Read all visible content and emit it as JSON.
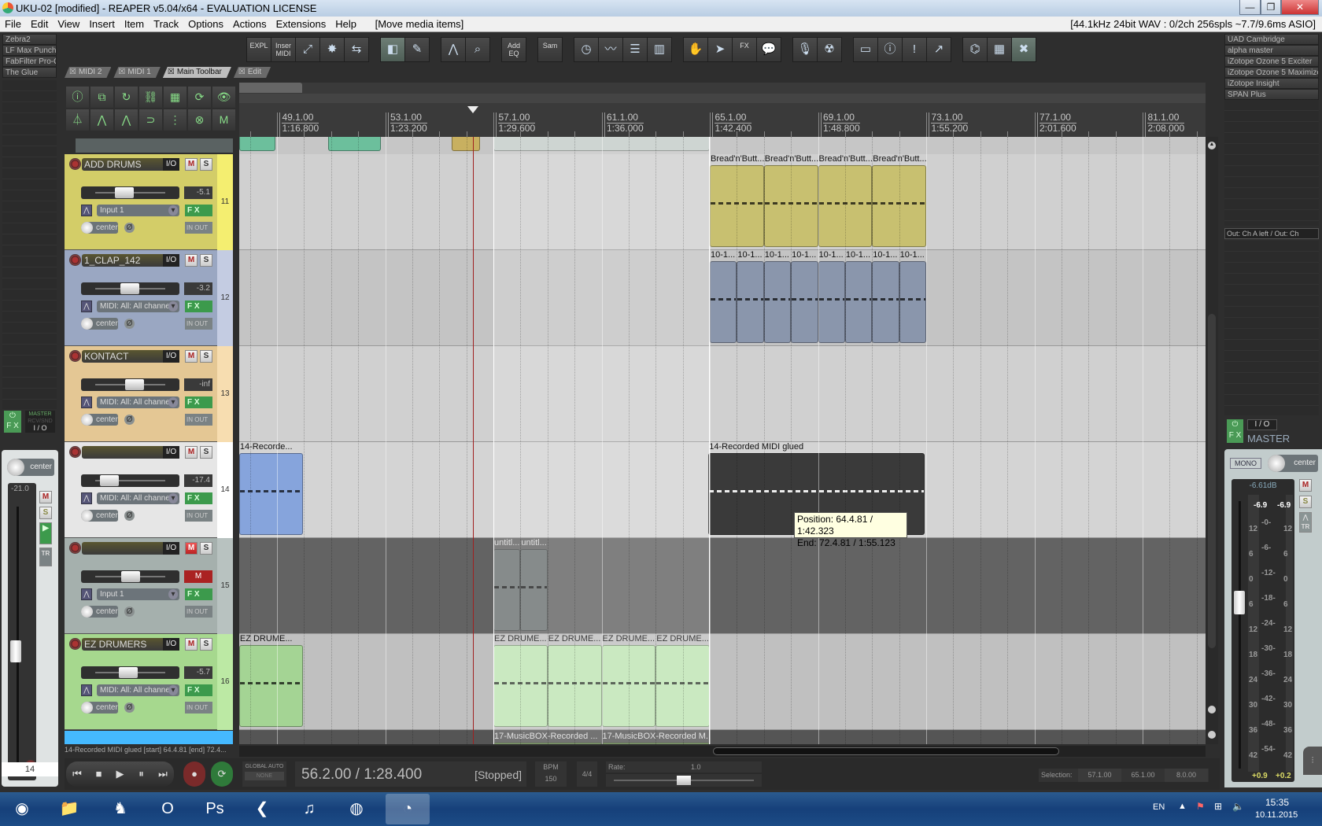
{
  "window": {
    "title": "UKU-02 [modified] - REAPER v5.04/x64 - EVALUATION LICENSE",
    "controls": [
      "—",
      "❐",
      "✕"
    ]
  },
  "menu": {
    "items": [
      "File",
      "Edit",
      "View",
      "Insert",
      "Item",
      "Track",
      "Options",
      "Actions",
      "Extensions",
      "Help"
    ],
    "last_action": "[Move media items]",
    "audio_status": "[44.1kHz 24bit WAV : 0/2ch 256spls ~7.7/9.6ms ASIO]"
  },
  "left_fx_list": [
    "Zebra2",
    "LF Max Punch",
    "FabFilter Pro-Q",
    "The Glue"
  ],
  "right_fx_list": [
    "UAD Cambridge",
    "alpha master",
    "iZotope Ozone 5 Exciter",
    "iZotope Ozone 5 Maximizer",
    "iZotope Insight",
    "SPAN Plus"
  ],
  "toolbar": {
    "groups": [
      [
        {
          "icon": "explorer-icon",
          "label": "EXPL"
        },
        {
          "icon": "insert-midi-icon",
          "label": "Inser MIDI"
        },
        {
          "icon": "fullscreen-icon",
          "glyph": "⤢"
        },
        {
          "icon": "explode-icon",
          "glyph": "✸"
        },
        {
          "icon": "routing-icon",
          "glyph": "⇆"
        }
      ],
      [
        {
          "icon": "snap-icon",
          "glyph": "◧",
          "on": true
        },
        {
          "icon": "pencil-icon",
          "glyph": "✎"
        }
      ],
      [
        {
          "icon": "envelope-icon",
          "glyph": "⋀"
        },
        {
          "icon": "zoom-icon",
          "glyph": "⌕"
        }
      ],
      [
        {
          "icon": "add-eq-icon",
          "label": "Add EQ"
        }
      ],
      [
        {
          "icon": "sample-icon",
          "label": "Sam"
        }
      ],
      [
        {
          "icon": "clock-icon",
          "glyph": "◷"
        },
        {
          "icon": "waveform-icon",
          "glyph": "〰"
        },
        {
          "icon": "tracklist-icon",
          "glyph": "☰"
        },
        {
          "icon": "mixer-icon",
          "glyph": "▥"
        }
      ],
      [
        {
          "icon": "hand-icon",
          "glyph": "✋"
        },
        {
          "icon": "cursor-icon",
          "glyph": "➤"
        },
        {
          "icon": "fx-icon",
          "label": "FX"
        },
        {
          "icon": "speech-icon",
          "glyph": "💬"
        }
      ],
      [
        {
          "icon": "microphone-icon",
          "glyph": "🎙"
        },
        {
          "icon": "radiation-icon",
          "glyph": "☢"
        }
      ],
      [
        {
          "icon": "screen-icon",
          "glyph": "▭"
        },
        {
          "icon": "wave-info-icon",
          "glyph": "ⓘ"
        },
        {
          "icon": "film-alert-icon",
          "glyph": "!"
        },
        {
          "icon": "pick-icon",
          "glyph": "↗"
        }
      ],
      [
        {
          "icon": "wave-disk-icon",
          "glyph": "⌬"
        },
        {
          "icon": "spectrum-icon",
          "glyph": "▦"
        },
        {
          "icon": "close-red-icon",
          "glyph": "✖",
          "on": true
        }
      ]
    ],
    "tabs": [
      {
        "label": "MIDI 2"
      },
      {
        "label": "MIDI 1"
      },
      {
        "label": "Main Toolbar",
        "active": true
      },
      {
        "label": "Edit"
      }
    ]
  },
  "small_toolbar": [
    {
      "icon": "item-info-icon",
      "glyph": "ⓘ"
    },
    {
      "icon": "glue-icon",
      "glyph": "⧉"
    },
    {
      "icon": "loop-item-icon",
      "glyph": "↻"
    },
    {
      "icon": "link-icon",
      "glyph": "⛓"
    },
    {
      "icon": "grid-hand-icon",
      "glyph": "▦"
    },
    {
      "icon": "repeat-icon",
      "glyph": "⟳"
    },
    {
      "icon": "eye-mixer-icon",
      "glyph": "👁"
    },
    {
      "icon": "metronome-icon",
      "glyph": "⏃"
    },
    {
      "icon": "envelope-edit-icon",
      "glyph": "⋀"
    },
    {
      "icon": "envelope-add-icon",
      "glyph": "⋀"
    },
    {
      "icon": "magnet-icon",
      "glyph": "⊃"
    },
    {
      "icon": "grid-icon",
      "glyph": "⋮"
    },
    {
      "icon": "rec-clear-icon",
      "glyph": "⊗"
    },
    {
      "icon": "mute-clear-icon",
      "glyph": "M"
    }
  ],
  "ruler": {
    "markers": [
      {
        "bar": "49.1.00",
        "time": "1:16.800"
      },
      {
        "bar": "53.1.00",
        "time": "1:23.200"
      },
      {
        "bar": "57.1.00",
        "time": "1:29.600"
      },
      {
        "bar": "61.1.00",
        "time": "1:36.000"
      },
      {
        "bar": "65.1.00",
        "time": "1:42.400"
      },
      {
        "bar": "69.1.00",
        "time": "1:48.800"
      },
      {
        "bar": "73.1.00",
        "time": "1:55.200"
      },
      {
        "bar": "77.1.00",
        "time": "2:01.600"
      },
      {
        "bar": "81.1.00",
        "time": "2:08.000"
      }
    ],
    "edit_cursor_bar": 56.25,
    "time_selection": [
      57,
      65
    ]
  },
  "tracks": [
    {
      "num": "11",
      "name": "ADD DRUMS",
      "volume": "-5.1",
      "fader": 0.55,
      "input": "Input 1",
      "muted": false,
      "panel": "#d3cd68",
      "numcol": "#f4ee70",
      "lane": "#d0d0d0",
      "items": [
        {
          "s": 65,
          "e": 67,
          "label": "Bread'n'Butt...",
          "color": "#c8c070"
        },
        {
          "s": 67,
          "e": 69,
          "label": "Bread'n'Butt...",
          "color": "#c8c070"
        },
        {
          "s": 69,
          "e": 71,
          "label": "Bread'n'Butt...",
          "color": "#c8c070"
        },
        {
          "s": 71,
          "e": 73,
          "label": "Bread'n'Butt...",
          "color": "#c8c070"
        }
      ]
    },
    {
      "num": "12",
      "name": "1_CLAP_142",
      "volume": "-3.2",
      "fader": 0.62,
      "input": "MIDI: All: All channe",
      "muted": false,
      "panel": "#9aa7c2",
      "numcol": "#c4cce2",
      "lane": "#c4c4c4",
      "items": [
        {
          "s": 65,
          "e": 66,
          "label": "10-1...",
          "color": "#8a96ac"
        },
        {
          "s": 66,
          "e": 67,
          "label": "10-1...",
          "color": "#8a96ac"
        },
        {
          "s": 67,
          "e": 68,
          "label": "10-1...",
          "color": "#8a96ac"
        },
        {
          "s": 68,
          "e": 69,
          "label": "10-1...",
          "color": "#8a96ac"
        },
        {
          "s": 69,
          "e": 70,
          "label": "10-1...",
          "color": "#8a96ac"
        },
        {
          "s": 70,
          "e": 71,
          "label": "10-1...",
          "color": "#8a96ac"
        },
        {
          "s": 71,
          "e": 72,
          "label": "10-1...",
          "color": "#8a96ac"
        },
        {
          "s": 72,
          "e": 73,
          "label": "10-1...",
          "color": "#8a96ac"
        }
      ]
    },
    {
      "num": "13",
      "name": "KONTACT",
      "volume": "-inf",
      "fader": 0.68,
      "input": "MIDI: All: All channe",
      "muted": false,
      "panel": "#e4c794",
      "numcol": "#f7ddb0",
      "lane": "#d0d0d0",
      "items": []
    },
    {
      "num": "14",
      "name": "",
      "volume": "-17.4",
      "fader": 0.36,
      "input": "MIDI: All: All channe",
      "muted": false,
      "panel": "#e6e6e6",
      "numcol": "#ffffff",
      "lane": "#d4d4d4",
      "items": [
        {
          "s": 47.6,
          "e": 49.95,
          "label": "14-Recorde...",
          "color": "#86a4dc"
        },
        {
          "s": 64.95,
          "e": 72.95,
          "label": "14-Recorded MIDI glued",
          "color": "#3a3a3a",
          "dark": true
        }
      ]
    },
    {
      "num": "15",
      "name": "",
      "volume": "",
      "fader": 0.63,
      "input": "Input 1",
      "muted": true,
      "panel": "#a5b0ad",
      "numcol": "#b8c2c0",
      "lane": "#636363",
      "items": [
        {
          "s": 57,
          "e": 58,
          "label": "untitl...",
          "color": "#6c7272"
        },
        {
          "s": 58,
          "e": 59,
          "label": "untitl...",
          "color": "#6c7272"
        }
      ]
    },
    {
      "num": "16",
      "name": "EZ DRUMERS",
      "volume": "-5.7",
      "fader": 0.6,
      "input": "MIDI: All: All channe",
      "muted": false,
      "panel": "#a6d88e",
      "numcol": "#bce9a4",
      "lane": "#c0c0c0",
      "items": [
        {
          "s": 47.6,
          "e": 49.95,
          "label": "EZ DRUME...",
          "color": "#a4d494"
        },
        {
          "s": 57,
          "e": 59,
          "label": "EZ DRUME...",
          "color": "#bfe4b4"
        },
        {
          "s": 59,
          "e": 61,
          "label": "EZ DRUME...",
          "color": "#bfe4b4"
        },
        {
          "s": 61,
          "e": 63,
          "label": "EZ DRUME...",
          "color": "#bfe4b4"
        },
        {
          "s": 63,
          "e": 65,
          "label": "EZ DRUME...",
          "color": "#bfe4b4"
        }
      ]
    }
  ],
  "track_17_items": [
    {
      "s": 57,
      "e": 61,
      "label": "17-MusicBOX-Recorded ..."
    },
    {
      "s": 61,
      "e": 65,
      "label": "17-MusicBOX-Recorded M..."
    }
  ],
  "top_row_items": [
    {
      "s": 47.6,
      "e": 48.95,
      "color": "#6cbf9c"
    },
    {
      "s": 50.9,
      "e": 52.85,
      "color": "#6cbf9c"
    },
    {
      "s": 55.45,
      "e": 56.5,
      "color": "#c8b060"
    },
    {
      "s": 57,
      "e": 65,
      "color": "#c4ccc8"
    }
  ],
  "tooltip": {
    "position": "Position: 64.4.81 / 1:42.323",
    "end": "End: 72.4.81 / 1:55.123"
  },
  "track_labels": {
    "io": "I/O",
    "mute": "M",
    "solo": "S",
    "fx": "F X",
    "pan": "center",
    "phase": "Ø",
    "inout": "IN OUT"
  },
  "status_line": "14-Recorded MIDI glued [start] 64.4.81 [end] 72.4...",
  "left_mixer": {
    "fx": "F X",
    "master_label": "MASTER",
    "rcv": "RCV/SND",
    "io": "I / O",
    "pan": "center",
    "volume": "-21.0",
    "mute": "M",
    "solo": "S",
    "track_number": "14",
    "tr": "TR"
  },
  "master": {
    "out": "Out: Ch A left / Out: Ch",
    "io": "I / O",
    "fx": "F X",
    "name": "MASTER",
    "mono": "MONO",
    "pan": "center",
    "db": "-6.61dB",
    "peak_l": "-6.9",
    "peak_r": "-6.9",
    "mute": "M",
    "solo": "S",
    "tr": "TR",
    "hold_l": "+0.9",
    "hold_r": "+0.2",
    "scale_center": [
      "-0-",
      "-6-",
      "-12-",
      "-18-",
      "-24-",
      "-30-",
      "-36-",
      "-42-",
      "-48-",
      "-54-"
    ],
    "scale_side": [
      "12",
      "6",
      "0",
      "6",
      "12",
      "18",
      "24",
      "30",
      "36",
      "42"
    ],
    "fader": 0.62
  },
  "transport": {
    "time": "56.2.00 / 1:28.400",
    "state": "[Stopped]",
    "global_auto": "GLOBAL AUTO",
    "auto_mode": "NONE",
    "bpm_label": "BPM",
    "bpm": "150",
    "timesig": "4/4",
    "rate_label": "Rate:",
    "rate": "1.0",
    "rate_pos": 0.5,
    "selection_label": "Selection:",
    "sel_start": "57.1.00",
    "sel_end": "65.1.00",
    "sel_len": "8.0.00"
  },
  "taskbar": {
    "apps": [
      {
        "icon": "start-orb-icon",
        "glyph": "◉"
      },
      {
        "icon": "explorer-folder-icon",
        "glyph": "📁"
      },
      {
        "icon": "fox-mask-icon",
        "glyph": "♞"
      },
      {
        "icon": "opera-icon",
        "glyph": "O"
      },
      {
        "icon": "photoshop-icon",
        "glyph": "Ps"
      },
      {
        "icon": "cubase-icon",
        "glyph": "❮"
      },
      {
        "icon": "installer-icon",
        "glyph": "♫"
      },
      {
        "icon": "firefox-icon",
        "glyph": "◍"
      },
      {
        "icon": "reaper-icon",
        "glyph": "◔"
      }
    ],
    "lang": "EN",
    "time": "15:35",
    "date": "10.11.2015"
  }
}
